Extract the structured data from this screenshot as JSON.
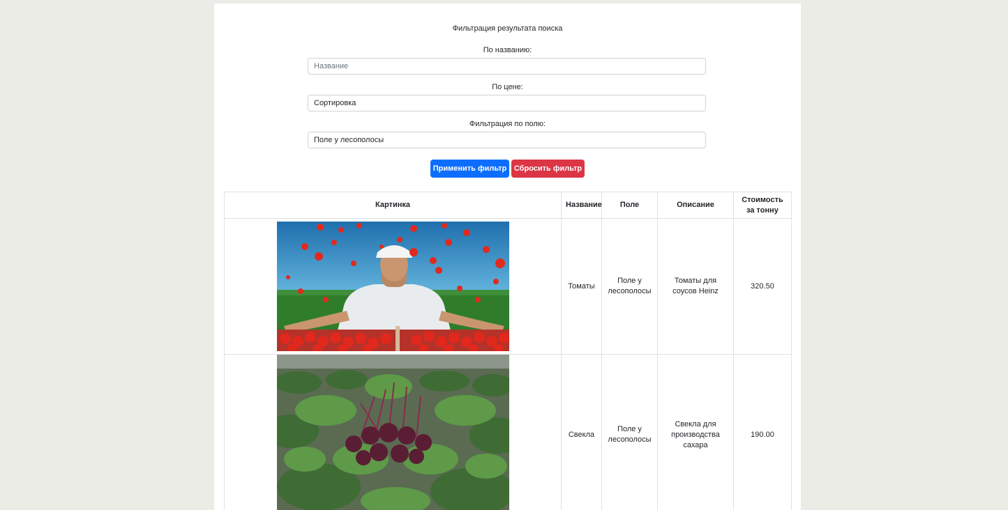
{
  "filter": {
    "title": "Фильтрация результата поиска",
    "name_label": "По названию:",
    "name_placeholder": "Название",
    "name_value": "",
    "price_label": "По цене:",
    "price_value": "Сортировка",
    "field_label": "Фильтрация по полю:",
    "field_value": "Поле у лесополосы",
    "apply_label": "Применить фильтр",
    "reset_label": "Сбросить фильтр"
  },
  "colors": {
    "page_bg": "#ecece6",
    "apply": "#0d6efd",
    "reset": "#dc3545"
  },
  "table": {
    "headers": [
      "Картинка",
      "Название",
      "Поле",
      "Описание",
      "Стоимость за тонну"
    ],
    "rows": [
      {
        "image": "tomato-farmer-photo",
        "name": "Томаты",
        "field": "Поле у лесополосы",
        "description": "Томаты для соусов Heinz",
        "price": "320.50"
      },
      {
        "image": "beet-field-photo",
        "name": "Свекла",
        "field": "Поле у лесополосы",
        "description": "Свекла для производства сахара",
        "price": "190.00"
      }
    ]
  }
}
